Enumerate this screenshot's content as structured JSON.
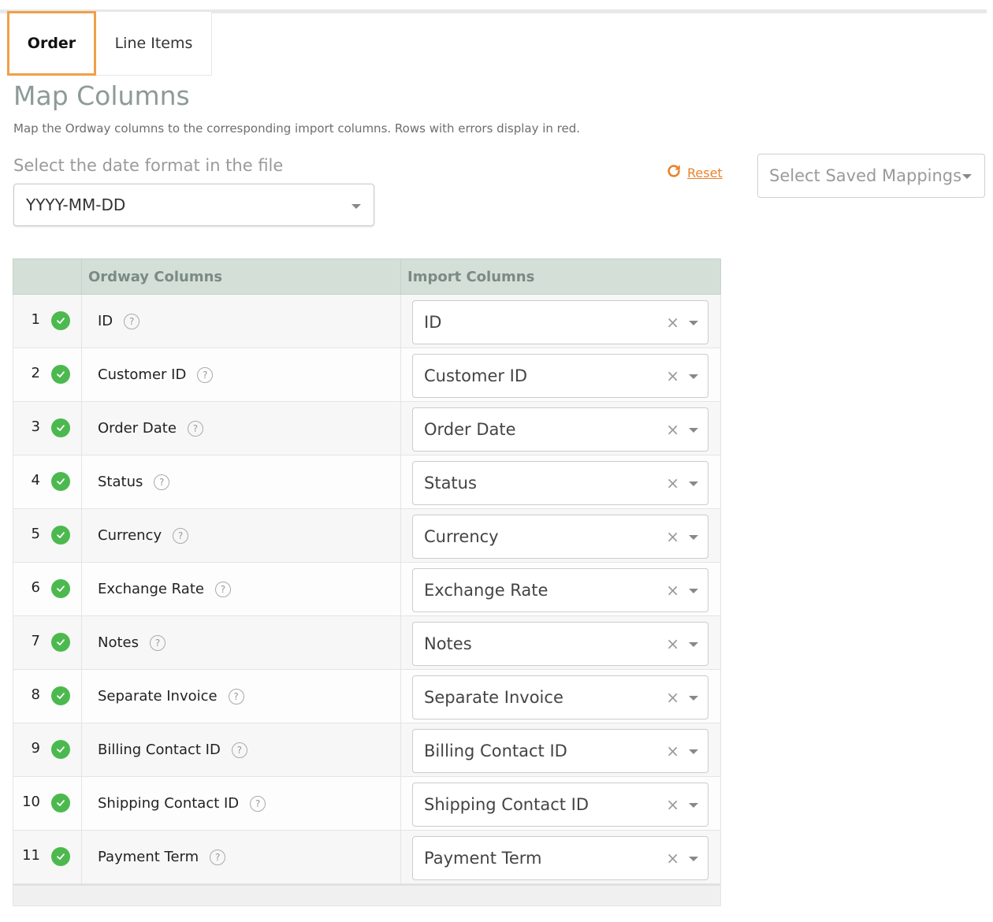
{
  "tabs": [
    {
      "label": "Order",
      "active": true
    },
    {
      "label": "Line Items",
      "active": false
    }
  ],
  "page": {
    "title": "Map Columns",
    "description": "Map the Ordway columns to the corresponding import columns. Rows with errors display in red."
  },
  "date_format": {
    "label": "Select the date format in the file",
    "value": "YYYY-MM-DD"
  },
  "reset": {
    "label": "Reset",
    "icon": "refresh-icon"
  },
  "saved_mappings": {
    "placeholder": "Select Saved Mappings"
  },
  "table": {
    "headers": {
      "number": "",
      "ordway": "Ordway Columns",
      "import": "Import Columns"
    },
    "rows": [
      {
        "num": "1",
        "ordway": "ID",
        "import": "ID"
      },
      {
        "num": "2",
        "ordway": "Customer ID",
        "import": "Customer ID"
      },
      {
        "num": "3",
        "ordway": "Order Date",
        "import": "Order Date"
      },
      {
        "num": "4",
        "ordway": "Status",
        "import": "Status"
      },
      {
        "num": "5",
        "ordway": "Currency",
        "import": "Currency"
      },
      {
        "num": "6",
        "ordway": "Exchange Rate",
        "import": "Exchange Rate"
      },
      {
        "num": "7",
        "ordway": "Notes",
        "import": "Notes"
      },
      {
        "num": "8",
        "ordway": "Separate Invoice",
        "import": "Separate Invoice"
      },
      {
        "num": "9",
        "ordway": "Billing Contact ID",
        "import": "Billing Contact ID"
      },
      {
        "num": "10",
        "ordway": "Shipping Contact ID",
        "import": "Shipping Contact ID"
      },
      {
        "num": "11",
        "ordway": "Payment Term",
        "import": "Payment Term"
      }
    ]
  },
  "colors": {
    "accent": "#e8822b",
    "active_tab_border": "#f0a048",
    "header_bg": "#d3dfd7",
    "success": "#4cb94f",
    "title": "#8d9a98"
  }
}
